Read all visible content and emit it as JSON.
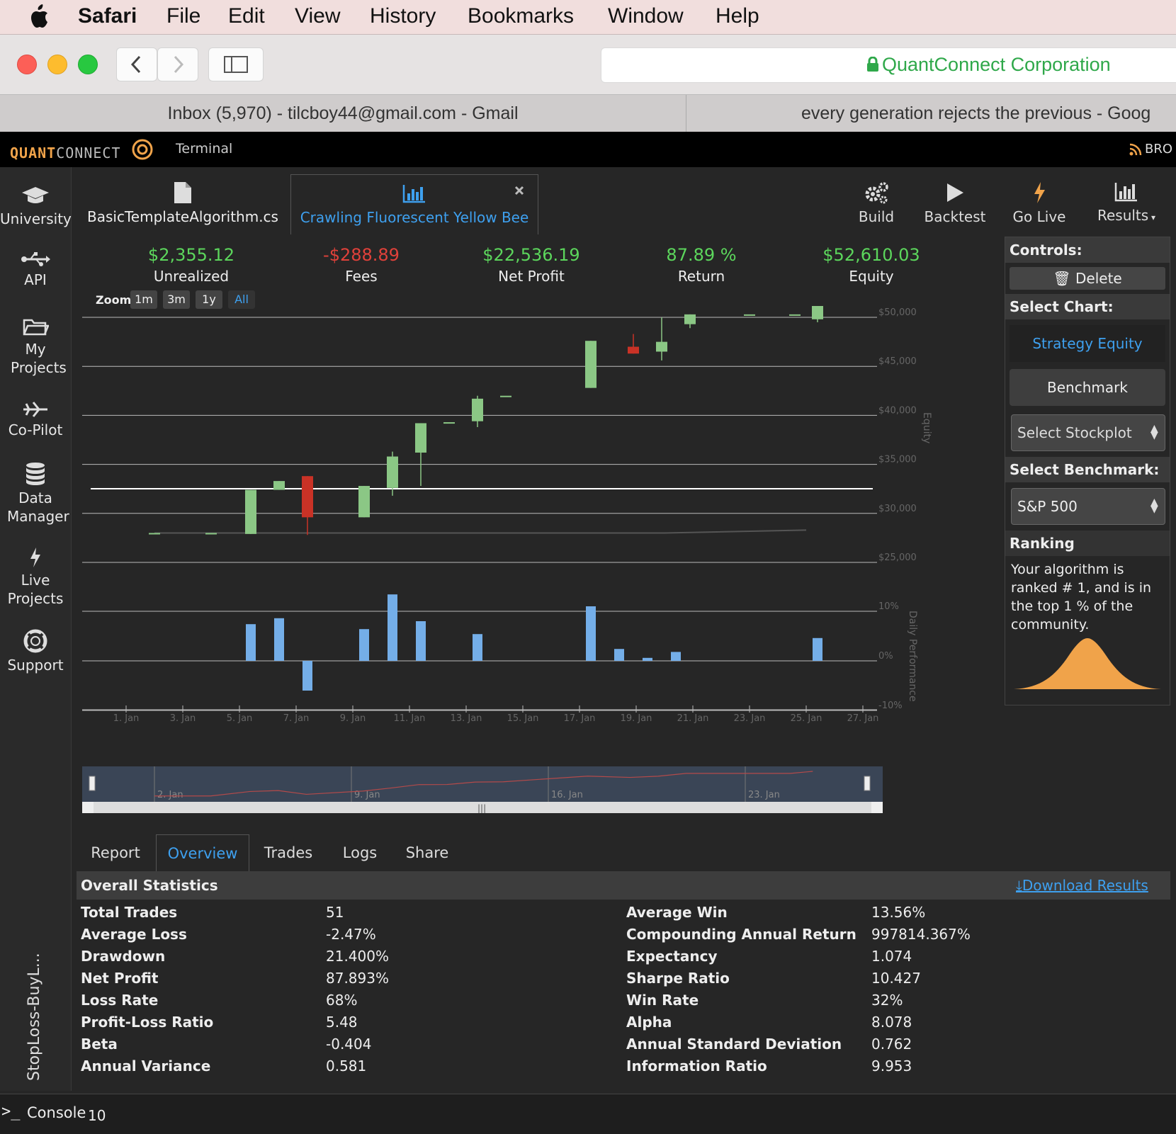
{
  "menubar": {
    "app": "Safari",
    "items": [
      "File",
      "Edit",
      "View",
      "History",
      "Bookmarks",
      "Window",
      "Help"
    ]
  },
  "toolbar": {
    "site_name": "QuantConnect Corporation",
    "secure_color": "#2fa84a"
  },
  "browser_tabs": [
    {
      "title": "Inbox (5,970) - tilcboy44@gmail.com - Gmail"
    },
    {
      "title": "every generation rejects the previous - Goog"
    }
  ],
  "qc_header": {
    "logo_left": "QUANT",
    "logo_right": "CONNECT",
    "section": "Terminal",
    "right_link": "BRO"
  },
  "sidebar": {
    "items": [
      {
        "label": "University",
        "icon": "graduation-cap-icon"
      },
      {
        "label": "API",
        "icon": "usb-icon"
      },
      {
        "label": "My Projects",
        "icon": "folder-icon"
      },
      {
        "label": "Co-Pilot",
        "icon": "plane-icon"
      },
      {
        "label": "Data Manager",
        "icon": "database-icon"
      },
      {
        "label": "Live Projects",
        "icon": "bolt-icon"
      },
      {
        "label": "Support",
        "icon": "lifebuoy-icon"
      }
    ],
    "project_vertical": "StopLoss-BuyL..."
  },
  "file_tabs": [
    {
      "label": "BasicTemplateAlgorithm.cs",
      "icon": "file-icon",
      "active": false
    },
    {
      "label": "Crawling Fluorescent Yellow Bee",
      "icon": "bar-chart-icon",
      "active": true
    }
  ],
  "actions": [
    {
      "label": "Build",
      "icon": "gears-icon"
    },
    {
      "label": "Backtest",
      "icon": "play-icon"
    },
    {
      "label": "Go Live",
      "icon": "bolt-icon"
    },
    {
      "label": "Results",
      "icon": "bar-chart-icon"
    }
  ],
  "summary": [
    {
      "value": "$2,355.12",
      "label": "Unrealized",
      "color": "#5cd65c"
    },
    {
      "value": "-$288.89",
      "label": "Fees",
      "color": "#e0413a"
    },
    {
      "value": "$22,536.19",
      "label": "Net Profit",
      "color": "#5cd65c"
    },
    {
      "value": "87.89 %",
      "label": "Return",
      "color": "#5cd65c"
    },
    {
      "value": "$52,610.03",
      "label": "Equity",
      "color": "#5cd65c"
    }
  ],
  "zoom": {
    "label": "Zoom",
    "options": [
      "1m",
      "3m",
      "1y",
      "All"
    ],
    "active": "All"
  },
  "chart_data": {
    "type": "candlestick",
    "equity_axis": {
      "label": "Equity",
      "ticks": [
        "$50,000",
        "$45,000",
        "$40,000",
        "$35,000",
        "$30,000",
        "$25,000"
      ],
      "ylim": [
        25000,
        50000
      ]
    },
    "perf_axis": {
      "label": "Daily Performance",
      "ticks": [
        "10%",
        "0%",
        "-10%"
      ],
      "ylim": [
        -10,
        10
      ]
    },
    "x_ticks": [
      "1. Jan",
      "3. Jan",
      "5. Jan",
      "7. Jan",
      "9. Jan",
      "11. Jan",
      "13. Jan",
      "15. Jan",
      "17. Jan",
      "19. Jan",
      "21. Jan",
      "23. Jan",
      "25. Jan",
      "27. Jan"
    ],
    "navigator_ticks": [
      "2. Jan",
      "9. Jan",
      "16. Jan",
      "23. Jan"
    ],
    "candles": [
      {
        "day": 2,
        "open": 28000,
        "close": 28000,
        "high": 28000,
        "low": 28000
      },
      {
        "day": 4,
        "open": 28000,
        "close": 28000,
        "high": 28000,
        "low": 28000
      },
      {
        "day": 5.4,
        "open": 27900,
        "close": 32400,
        "high": 32400,
        "low": 27900
      },
      {
        "day": 6.4,
        "open": 32400,
        "close": 33300,
        "high": 33300,
        "low": 32400
      },
      {
        "day": 7.4,
        "open": 33800,
        "close": 29600,
        "high": 33800,
        "low": 27800
      },
      {
        "day": 9.4,
        "open": 29600,
        "close": 32800,
        "high": 32800,
        "low": 29600
      },
      {
        "day": 10.4,
        "open": 32600,
        "close": 35800,
        "high": 36300,
        "low": 31800
      },
      {
        "day": 11.4,
        "open": 36200,
        "close": 39200,
        "high": 39200,
        "low": 32800
      },
      {
        "day": 12.4,
        "open": 39300,
        "close": 39300,
        "high": 39300,
        "low": 39300
      },
      {
        "day": 13.4,
        "open": 39400,
        "close": 41700,
        "high": 42000,
        "low": 38800
      },
      {
        "day": 14.4,
        "open": 42000,
        "close": 42000,
        "high": 42000,
        "low": 42000
      },
      {
        "day": 17.4,
        "open": 42800,
        "close": 47600,
        "high": 47600,
        "low": 42800
      },
      {
        "day": 18.9,
        "open": 47000,
        "close": 46300,
        "high": 48300,
        "low": 46300
      },
      {
        "day": 19.9,
        "open": 46500,
        "close": 47500,
        "high": 50000,
        "low": 45600
      },
      {
        "day": 20.9,
        "open": 49300,
        "close": 50300,
        "high": 50300,
        "low": 48900
      },
      {
        "day": 23,
        "open": 50300,
        "close": 50300,
        "high": 50300,
        "low": 50300
      },
      {
        "day": 24.6,
        "open": 50300,
        "close": 50300,
        "high": 50300,
        "low": 50300
      },
      {
        "day": 25.4,
        "open": 49800,
        "close": 52300,
        "high": 52300,
        "low": 49500
      }
    ],
    "benchmark_line": [
      [
        2,
        28000
      ],
      [
        10,
        28000
      ],
      [
        20,
        28000
      ],
      [
        25,
        28300
      ]
    ],
    "daily_performance": [
      {
        "day": 5.4,
        "value": 7.4
      },
      {
        "day": 6.4,
        "value": 8.6
      },
      {
        "day": 7.4,
        "value": -6.0
      },
      {
        "day": 9.4,
        "value": 6.4
      },
      {
        "day": 10.4,
        "value": 13.4
      },
      {
        "day": 11.4,
        "value": 8.0
      },
      {
        "day": 13.4,
        "value": 5.4
      },
      {
        "day": 17.4,
        "value": 11.0
      },
      {
        "day": 18.4,
        "value": 2.4
      },
      {
        "day": 19.4,
        "value": 0.6
      },
      {
        "day": 20.4,
        "value": 1.8
      },
      {
        "day": 25.4,
        "value": 4.6
      }
    ],
    "colors": {
      "up": "#8bc785",
      "down": "#c93226",
      "perf": "#74aee8",
      "grid": "#bbbbbb"
    }
  },
  "controls": {
    "header": "Controls:",
    "delete": "Delete",
    "select_chart": "Select Chart:",
    "chart_options": [
      "Strategy Equity",
      "Benchmark"
    ],
    "stockplot": "Select Stockplot",
    "select_benchmark": "Select Benchmark:",
    "benchmark_value": "S&P 500",
    "ranking_header": "Ranking",
    "ranking_text": "Your algorithm is ranked # 1, and is in the top 1 % of the community."
  },
  "bottom_tabs": {
    "items": [
      "Report",
      "Overview",
      "Trades",
      "Logs",
      "Share"
    ],
    "active": "Overview"
  },
  "statistics": {
    "title": "Overall Statistics",
    "download": "Download Results",
    "left": [
      [
        "Total Trades",
        "51"
      ],
      [
        "Average Loss",
        "-2.47%"
      ],
      [
        "Drawdown",
        "21.400%"
      ],
      [
        "Net Profit",
        "87.893%"
      ],
      [
        "Loss Rate",
        "68%"
      ],
      [
        "Profit-Loss Ratio",
        "5.48"
      ],
      [
        "Beta",
        "-0.404"
      ],
      [
        "Annual Variance",
        "0.581"
      ]
    ],
    "right": [
      [
        "Average Win",
        "13.56%"
      ],
      [
        "Compounding Annual Return",
        "997814.367%"
      ],
      [
        "Expectancy",
        "1.074"
      ],
      [
        "Sharpe Ratio",
        "10.427"
      ],
      [
        "Win Rate",
        "32%"
      ],
      [
        "Alpha",
        "8.078"
      ],
      [
        "Annual Standard Deviation",
        "0.762"
      ],
      [
        "Information Ratio",
        "9.953"
      ]
    ]
  },
  "console": {
    "label": "Console",
    "count": "10"
  }
}
